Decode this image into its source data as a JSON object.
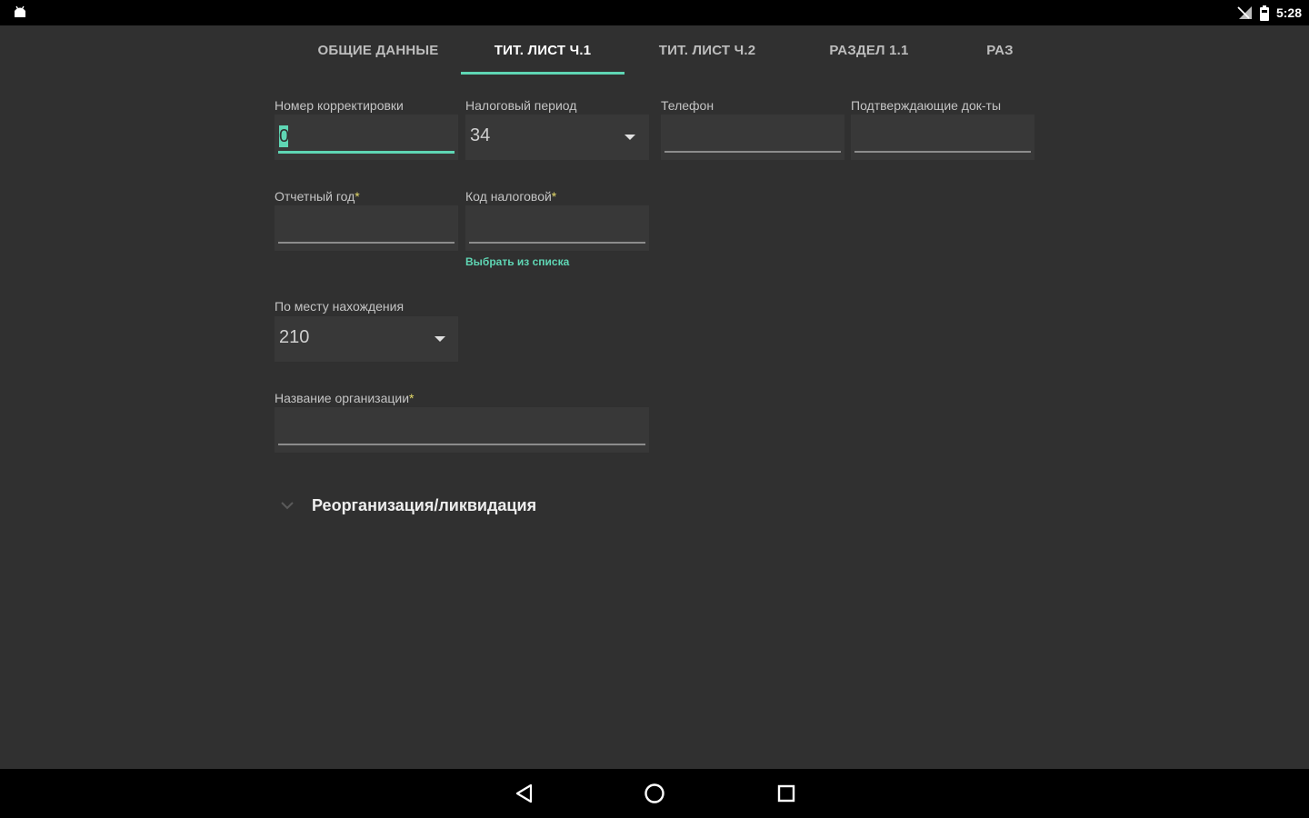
{
  "status_bar": {
    "time": "5:28",
    "icons": [
      "android-icon",
      "signal-off-icon",
      "battery-icon"
    ]
  },
  "tabs": [
    {
      "label": "ОБЩИЕ ДАННЫЕ",
      "active": false
    },
    {
      "label": "ТИТ. ЛИСТ Ч.1",
      "active": true
    },
    {
      "label": "ТИТ. ЛИСТ Ч.2",
      "active": false
    },
    {
      "label": "РАЗДЕЛ 1.1",
      "active": false
    },
    {
      "label": "РАЗ",
      "active": false
    }
  ],
  "form": {
    "correction_number": {
      "label": "Номер корректировки",
      "value": "0"
    },
    "tax_period": {
      "label": "Налоговый период",
      "value": "34"
    },
    "phone": {
      "label": "Телефон",
      "value": ""
    },
    "supporting_docs": {
      "label": "Подтверждающие док-ты",
      "value": ""
    },
    "reporting_year": {
      "label": "Отчетный год",
      "required_mark": "*",
      "value": ""
    },
    "tax_code": {
      "label": "Код налоговой",
      "required_mark": "*",
      "value": "",
      "link": "Выбрать из списка"
    },
    "location": {
      "label": "По месту нахождения",
      "value": "210"
    },
    "org_name": {
      "label": "Название организации",
      "required_mark": "*",
      "value": ""
    }
  },
  "section": {
    "title": "Реорганизация/ликвидация"
  },
  "colors": {
    "accent": "#5fd6b4",
    "required": "#e3d96a",
    "background": "#303030"
  }
}
